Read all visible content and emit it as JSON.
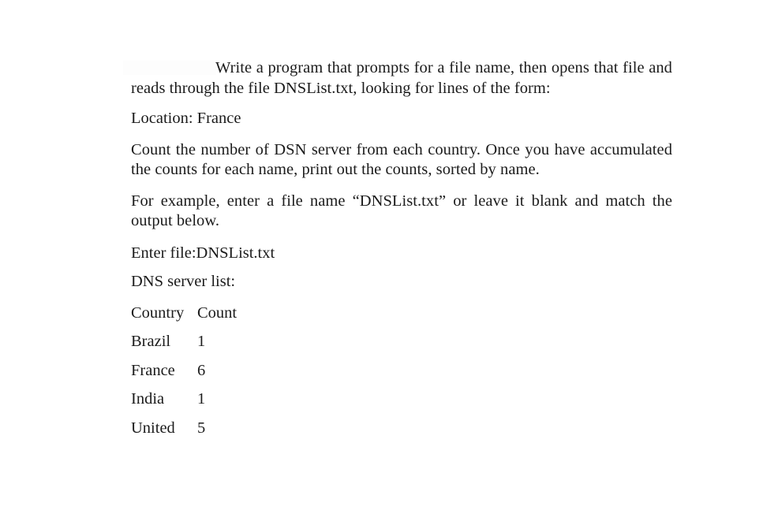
{
  "document": {
    "page_background": "#ffffff",
    "text_color": "#1b1b1b",
    "body": {
      "paragraph_1": "Write a program that prompts for a file name, then opens that file and reads through the file DNSList.txt, looking for lines of the form:",
      "sample_line": "Location: France",
      "paragraph_2": "Count the number of DSN server from each country. Once you have accumulated the counts for each name, print out the counts, sorted by name.",
      "paragraph_3": "For example, enter a file name “DNSList.txt” or leave it blank and match the output below."
    },
    "output": {
      "prompt_line": "Enter file:DNSList.txt",
      "list_header": "DNS server list:",
      "table": {
        "headers": [
          "Country",
          "Count"
        ],
        "rows": [
          {
            "country": "Brazil",
            "count": "1"
          },
          {
            "country": "France",
            "count": "6"
          },
          {
            "country": "India",
            "count": "1"
          },
          {
            "country": "United",
            "count": "5"
          }
        ]
      }
    }
  }
}
